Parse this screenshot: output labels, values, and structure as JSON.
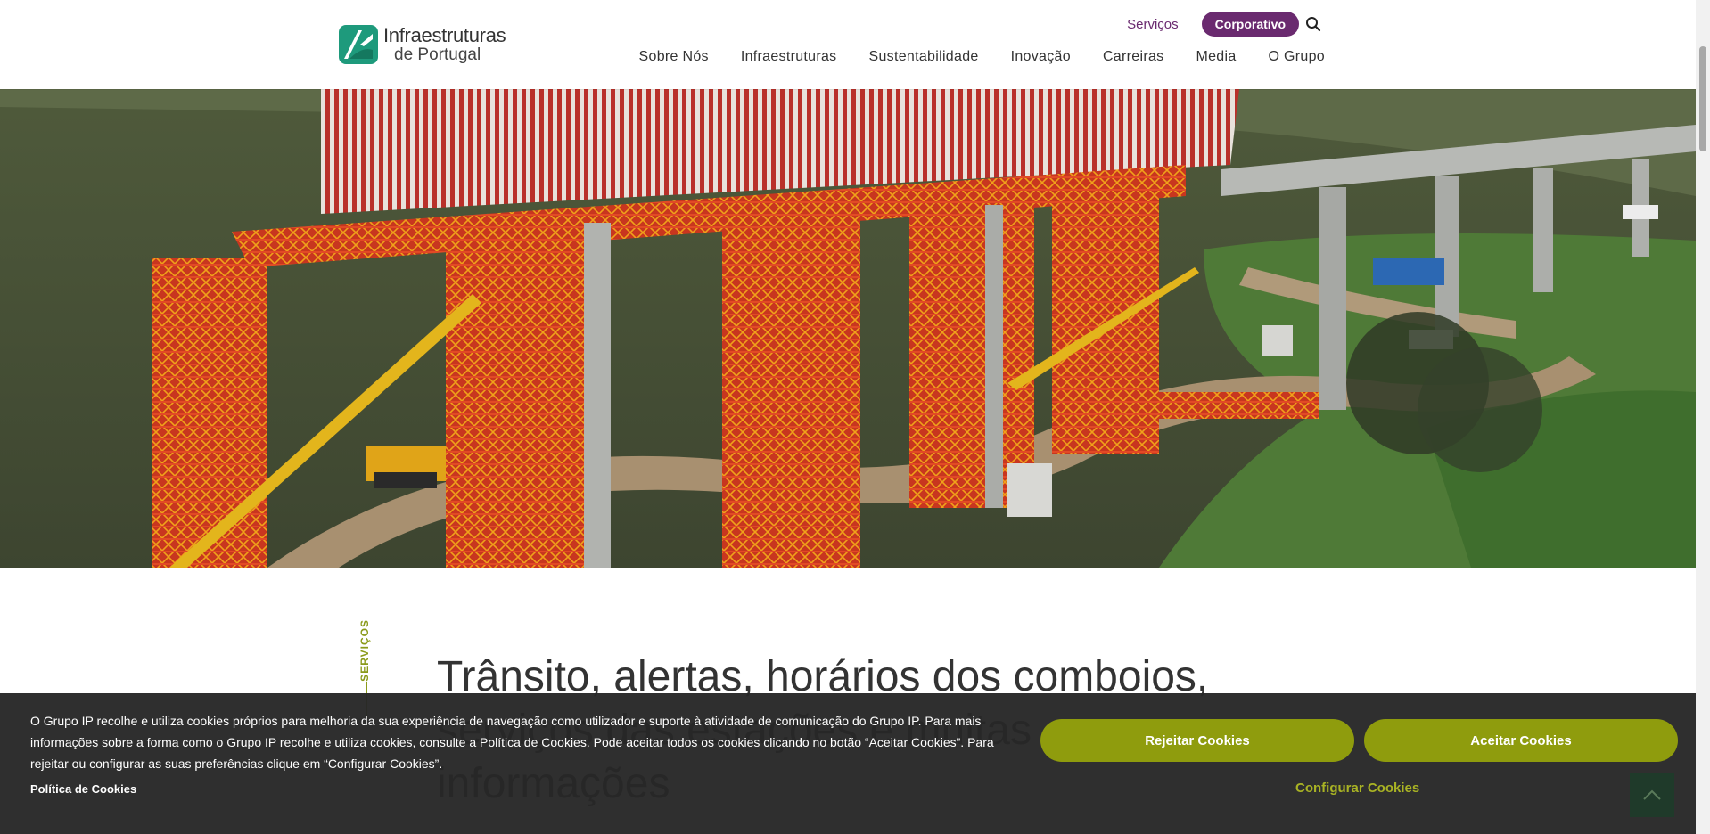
{
  "header": {
    "logo_line1": "Infraestruturas",
    "logo_line2": "de Portugal",
    "servicos_link": "Serviços",
    "corporativo_button": "Corporativo",
    "nav": [
      "Sobre Nós",
      "Infraestruturas",
      "Sustentabilidade",
      "Inovação",
      "Carreiras",
      "Media",
      "O Grupo"
    ]
  },
  "hero": {
    "alt": "viaduct construction"
  },
  "section": {
    "tag": "SERVIÇOS",
    "headline": "Trânsito, alertas, horários dos comboios, serviços das estações e muitas informações"
  },
  "cookie": {
    "text": "O Grupo IP recolhe e utiliza cookies próprios para melhoria da sua experiência de navegação como utilizador e suporte à atividade de comunicação do Grupo IP. Para mais informações sobre a forma como o Grupo IP recolhe e utiliza cookies, consulte a Política de Cookies. Pode aceitar todos os cookies clicando no botão “Aceitar Cookies”. Para rejeitar ou configurar as suas preferências clique em “Configurar Cookies”.",
    "policy_link": "Política de Cookies",
    "reject_button": "Rejeitar Cookies",
    "accept_button": "Aceitar Cookies",
    "configure_button": "Configurar Cookies"
  },
  "colors": {
    "brand_purple": "#6a2a6f",
    "accent_green": "#8f9c0d",
    "logo_teal": "#1e9a7c"
  }
}
